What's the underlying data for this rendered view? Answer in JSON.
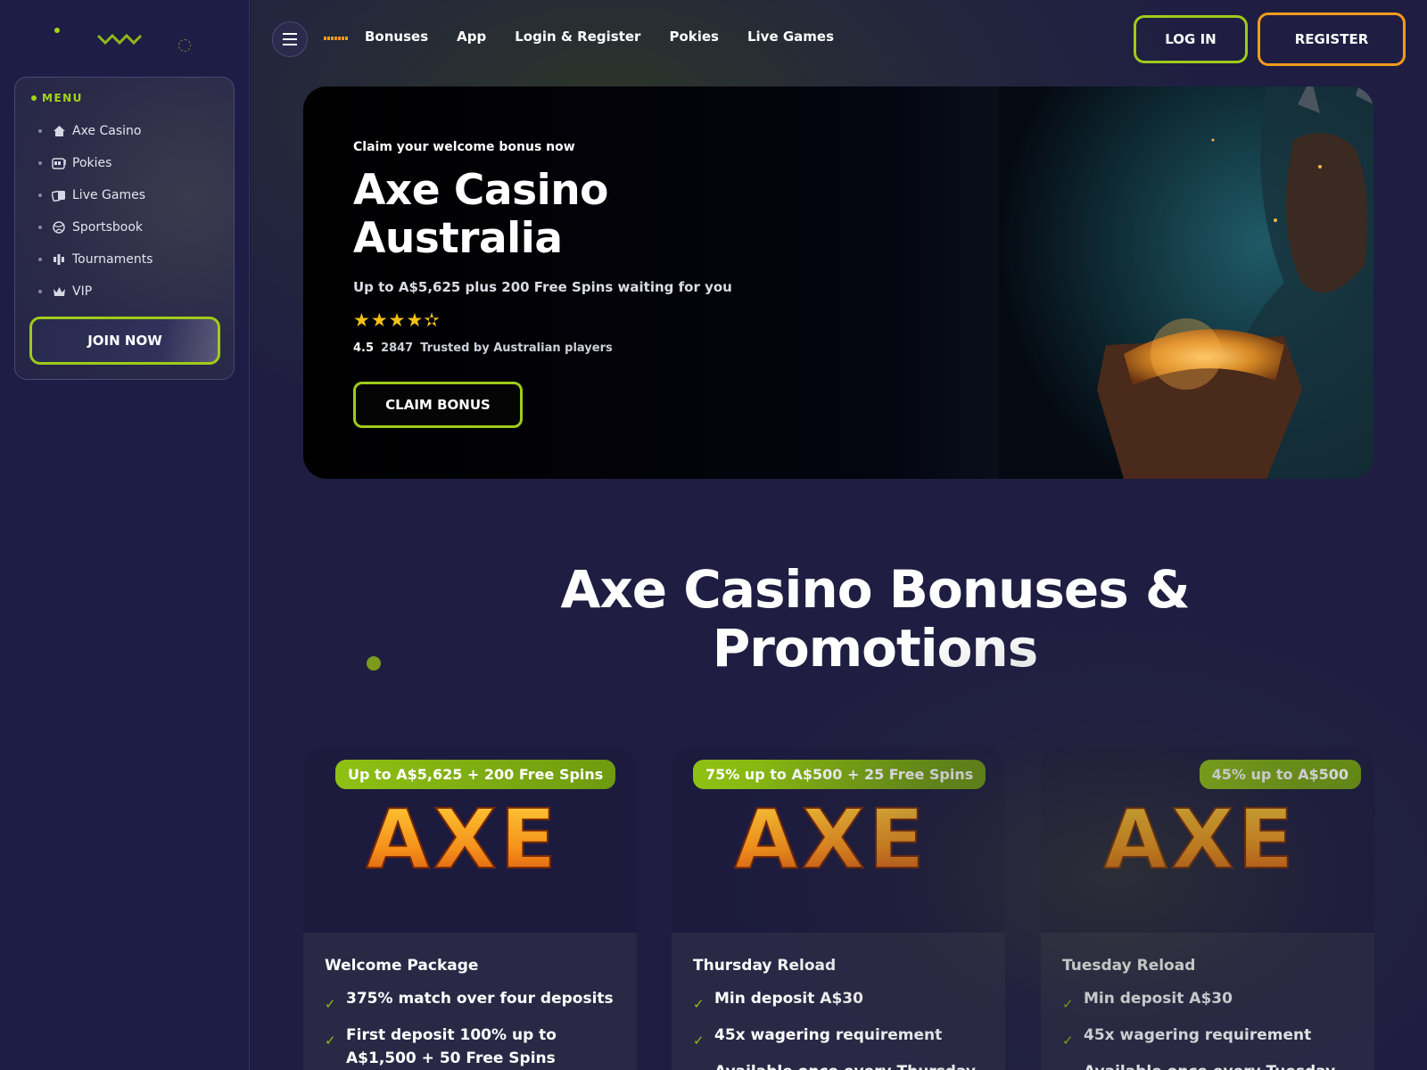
{
  "sidebar": {
    "menu_title": "MENU",
    "items": [
      {
        "label": "Axe Casino",
        "icon": "home-icon"
      },
      {
        "label": "Pokies",
        "icon": "slot-machine-icon"
      },
      {
        "label": "Live Games",
        "icon": "cards-icon"
      },
      {
        "label": "Sportsbook",
        "icon": "ball-icon"
      },
      {
        "label": "Tournaments",
        "icon": "trophy-icon"
      },
      {
        "label": "VIP",
        "icon": "crown-icon"
      }
    ],
    "join_label": "JOIN NOW"
  },
  "header": {
    "nav": [
      "Bonuses",
      "App",
      "Login & Register",
      "Pokies",
      "Live Games"
    ],
    "login_label": "LOG IN",
    "register_label": "REGISTER"
  },
  "hero": {
    "subtitle": "Claim your welcome bonus now",
    "title": "Axe Casino Australia",
    "description": "Up to A$5,625 plus 200 Free Spins waiting for you",
    "stars": "★★★★✫",
    "rating_value": 4.5,
    "rating": "4.5",
    "reviews": "2847",
    "trust_text": "Trusted by Australian players",
    "cta_label": "CLAIM BONUS"
  },
  "section": {
    "title": "Axe Casino Bonuses & Promotions"
  },
  "cards": [
    {
      "badge": "Up to A$5,625 + 200 Free Spins",
      "logo_text": "AXE",
      "name": "Welcome Package",
      "features": [
        "375% match over four deposits",
        "First deposit 100% up to A$1,500 + 50 Free Spins"
      ]
    },
    {
      "badge": "75% up to A$500 + 25 Free Spins",
      "logo_text": "AXE",
      "name": "Thursday Reload",
      "features": [
        "Min deposit A$30",
        "45x wagering requirement",
        "Available once every Thursday"
      ]
    },
    {
      "badge": "45% up to A$500",
      "logo_text": "AXE",
      "name": "Tuesday Reload",
      "features": [
        "Min deposit A$30",
        "45x wagering requirement",
        "Available once every Tuesday"
      ]
    }
  ],
  "colors": {
    "accent_green": "#9fcb1a",
    "accent_orange": "#f59b1c",
    "background": "#1e1d45",
    "star": "#f4c118"
  }
}
